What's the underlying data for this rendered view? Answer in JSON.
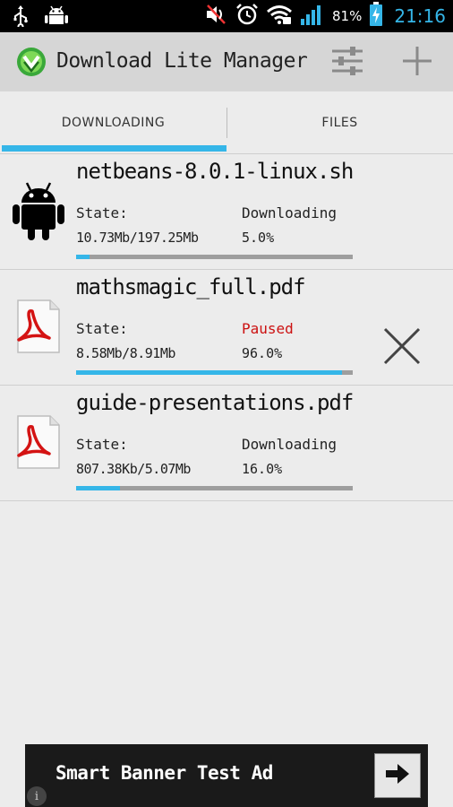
{
  "status_bar": {
    "battery_percent": "81%",
    "time": "21:16",
    "icons": [
      "usb-icon",
      "android-debug-icon",
      "mute-icon",
      "alarm-icon",
      "wifi-icon",
      "signal-icon",
      "battery-charging-icon"
    ]
  },
  "app": {
    "title": "Download Lite Manager",
    "logo_icon": "download-logo-icon",
    "settings_icon": "sliders-icon",
    "add_icon": "plus-icon"
  },
  "tabs": [
    {
      "label": "DOWNLOADING",
      "selected": true
    },
    {
      "label": "FILES",
      "selected": false
    }
  ],
  "downloads": [
    {
      "name": "netbeans-8.0.1-linux.sh",
      "icon": "android-icon",
      "state_label": "State:",
      "state": "Downloading",
      "size": "10.73Mb/197.25Mb",
      "percent": "5.0%",
      "progress": 0.05,
      "cancel_visible": false
    },
    {
      "name": "mathsmagic_full.pdf",
      "icon": "pdf-icon",
      "state_label": "State:",
      "state": "Paused",
      "size": "8.58Mb/8.91Mb",
      "percent": "96.0%",
      "progress": 0.96,
      "cancel_visible": true
    },
    {
      "name": "guide-presentations.pdf",
      "icon": "pdf-icon",
      "state_label": "State:",
      "state": "Downloading",
      "size": "807.38Kb/5.07Mb",
      "percent": "16.0%",
      "progress": 0.16,
      "cancel_visible": false
    }
  ],
  "ad": {
    "text": "Smart Banner Test Ad",
    "info_glyph": "i"
  },
  "colors": {
    "accent": "#35b6e8",
    "paused": "#cc1111",
    "actionbar": "#d6d6d6",
    "background": "#ececec"
  }
}
